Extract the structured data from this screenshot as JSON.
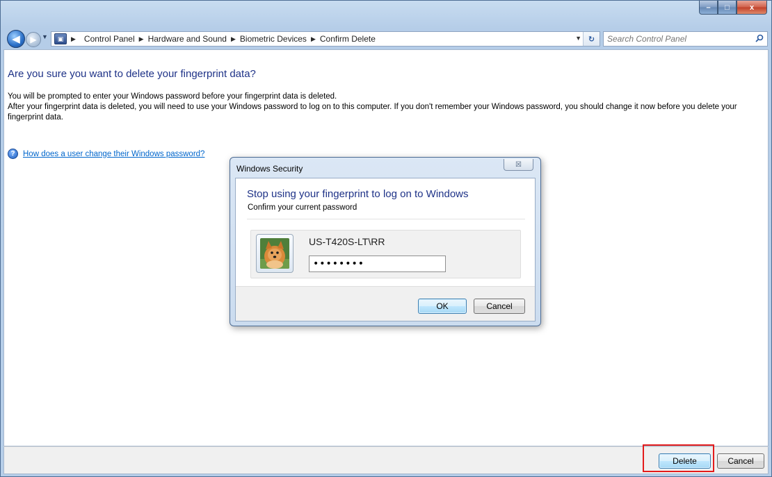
{
  "window": {
    "caption_min": "–",
    "caption_max": "□",
    "caption_close": "x"
  },
  "nav": {
    "breadcrumbs": [
      "Control Panel",
      "Hardware and Sound",
      "Biometric Devices",
      "Confirm Delete"
    ],
    "search_placeholder": "Search Control Panel"
  },
  "content": {
    "title": "Are you sure you want to delete your fingerprint data?",
    "line1": "You will be prompted to enter your Windows password before your fingerprint data is deleted.",
    "line2": "After your fingerprint data is deleted, you will need to use your Windows password to log on to this computer.  If you don't remember your Windows password, you should change it now before you delete your fingerprint data.",
    "help_link": "How does a user change their Windows password?"
  },
  "footer": {
    "delete_label": "Delete",
    "cancel_label": "Cancel"
  },
  "dialog": {
    "title": "Windows Security",
    "close_glyph": "☒",
    "heading": "Stop using your fingerprint to log on to Windows",
    "subheading": "Confirm your current password",
    "username": "US-T420S-LT\\RR",
    "password_value": "••••••••",
    "ok_label": "OK",
    "cancel_label": "Cancel"
  },
  "colors": {
    "heading_blue": "#1e3287",
    "link_blue": "#0066cc",
    "highlight_red": "#e31b1b"
  }
}
